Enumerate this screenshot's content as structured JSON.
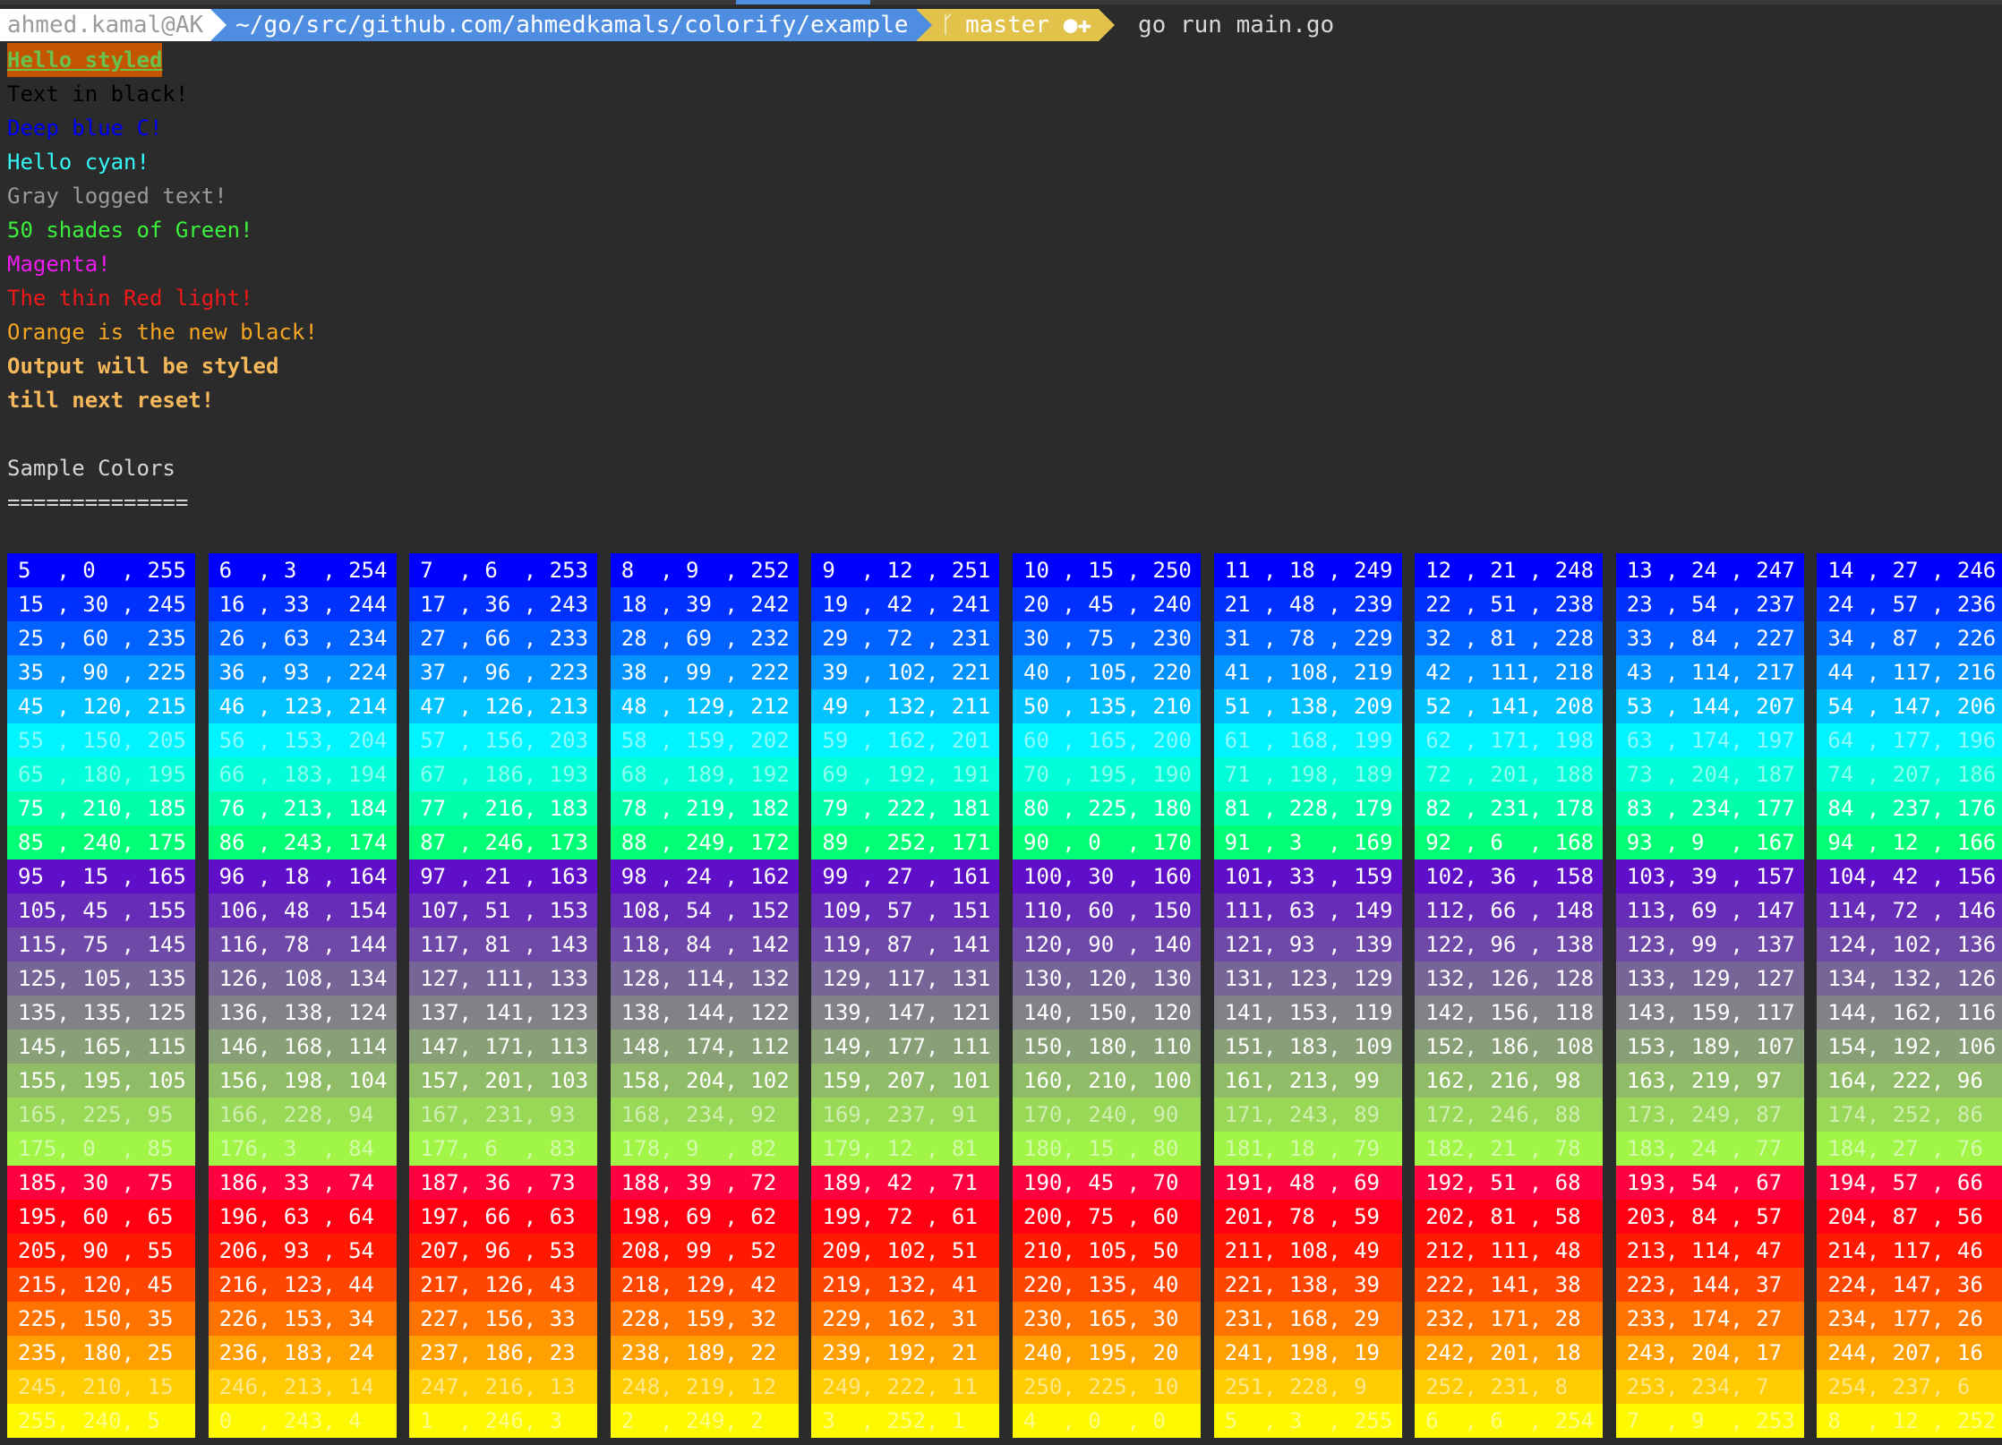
{
  "prompt": {
    "user": "ahmed.kamal@AK",
    "path": "~/go/src/github.com/ahmedkamals/colorify/example",
    "branch_icon": "branch-icon",
    "branch": "master ●✚",
    "command": "go run main.go"
  },
  "output": {
    "hello_styled": "Hello styled",
    "text_black": "Text in black!",
    "deep_blue": "Deep blue C!",
    "hello_cyan": "Hello cyan!",
    "gray_logged": "Gray logged text!",
    "green": "50 shades of Green!",
    "magenta": "Magenta!",
    "red": "The thin Red light!",
    "orange": "Orange is the new black!",
    "styled1": "Output will be styled",
    "styled2": "till next reset!",
    "sample_title": "Sample Colors",
    "underline": "=============="
  },
  "colors": {
    "background": "#2b2b2b",
    "styled_bg": "#c45500",
    "styled_fg": "#6ac24e",
    "black": "#000000",
    "blue": "#0000f5",
    "cyan": "#35f6f6",
    "gray": "#9b9b9b",
    "green": "#3cf03c",
    "magenta": "#f01bf0",
    "red": "#f01818",
    "orange": "#f5a623"
  }
}
